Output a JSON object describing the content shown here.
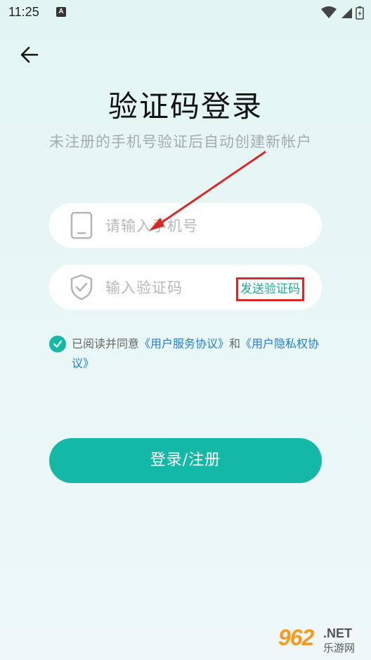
{
  "status_bar": {
    "time": "11:25",
    "notification_label": "A"
  },
  "header": {
    "back_icon": "arrow-left-icon"
  },
  "main": {
    "title": "验证码登录",
    "subtitle": "未注册的手机号验证后自动创建新帐户"
  },
  "phone_field": {
    "placeholder": "请输入手机号",
    "value": "",
    "icon": "phone-icon"
  },
  "code_field": {
    "placeholder": "输入验证码",
    "value": "",
    "icon": "shield-check-icon",
    "send_label": "发送验证码"
  },
  "agreement": {
    "checked": true,
    "prefix": "已阅读并同意",
    "link1": "《用户服务协议》",
    "middle": "和",
    "link2": "《用户隐私权协议》"
  },
  "login_button": {
    "label": "登录/注册"
  },
  "watermark": {
    "number": "962",
    "domain": ".NET",
    "site_name": "乐游网"
  },
  "colors": {
    "accent": "#13b8a6",
    "link": "#1f7fd6",
    "annotation": "#d32a2a",
    "placeholder": "#b5b9bd"
  }
}
